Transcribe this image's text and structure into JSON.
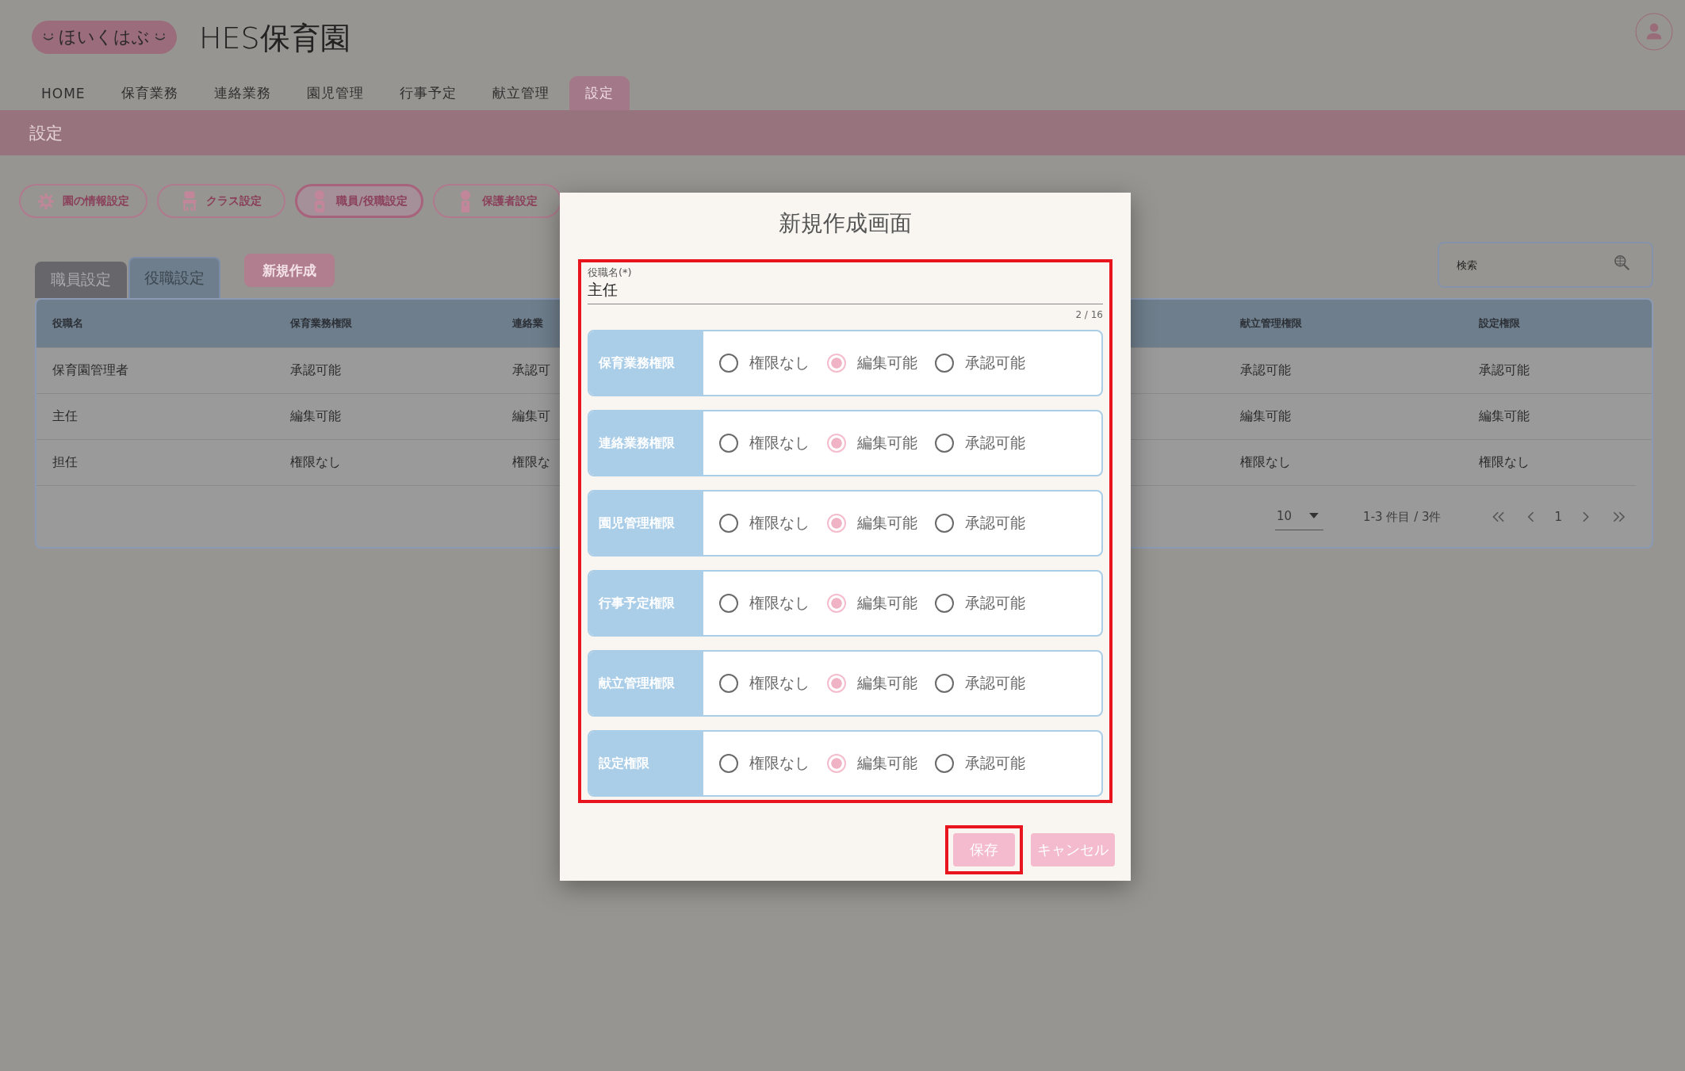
{
  "header": {
    "logo": "ほいくはぶ",
    "title": "HES保育園"
  },
  "nav": [
    {
      "label": "HOME",
      "selected": false
    },
    {
      "label": "保育業務",
      "selected": false
    },
    {
      "label": "連絡業務",
      "selected": false
    },
    {
      "label": "園児管理",
      "selected": false
    },
    {
      "label": "行事予定",
      "selected": false
    },
    {
      "label": "献立管理",
      "selected": false
    },
    {
      "label": "設定",
      "selected": true
    }
  ],
  "page_title": "設定",
  "settings_buttons": [
    {
      "label": "園の情報設定",
      "kind": "gear",
      "selected": false
    },
    {
      "label": "クラス設定",
      "kind": "chair",
      "selected": false
    },
    {
      "label": "職員/役職設定",
      "kind": "staff",
      "selected": true
    },
    {
      "label": "保護者設定",
      "kind": "guardian",
      "selected": false
    }
  ],
  "tabs": [
    {
      "label": "職員設定",
      "selected": false
    },
    {
      "label": "役職設定",
      "selected": true
    }
  ],
  "new_button": "新規作成",
  "search": {
    "placeholder": "検索"
  },
  "table": {
    "columns": [
      "役職名",
      "保育業務権限",
      "連絡業",
      "献立管理権限",
      "設定権限"
    ],
    "rows": [
      [
        "保育園管理者",
        "承認可能",
        "承認可",
        "承認可能",
        "承認可能"
      ],
      [
        "主任",
        "編集可能",
        "編集可",
        "編集可能",
        "編集可能"
      ],
      [
        "担任",
        "権限なし",
        "権限な",
        "権限なし",
        "権限なし"
      ]
    ]
  },
  "pagination": {
    "per_page": "10",
    "range": "1-3 件目 / 3件",
    "page": "1"
  },
  "dialog": {
    "title": "新規作成画面",
    "form_highlighted": true,
    "field": {
      "label": "役職名(*)",
      "value": "主任",
      "counter": "2 / 16"
    },
    "permissions": [
      {
        "label": "保育業務権限",
        "options": [
          {
            "label": "権限なし",
            "selected": false
          },
          {
            "label": "編集可能",
            "selected": true
          },
          {
            "label": "承認可能",
            "selected": false
          }
        ]
      },
      {
        "label": "連絡業務権限",
        "options": [
          {
            "label": "権限なし",
            "selected": false
          },
          {
            "label": "編集可能",
            "selected": true
          },
          {
            "label": "承認可能",
            "selected": false
          }
        ]
      },
      {
        "label": "園児管理権限",
        "options": [
          {
            "label": "権限なし",
            "selected": false
          },
          {
            "label": "編集可能",
            "selected": true
          },
          {
            "label": "承認可能",
            "selected": false
          }
        ]
      },
      {
        "label": "行事予定権限",
        "options": [
          {
            "label": "権限なし",
            "selected": false
          },
          {
            "label": "編集可能",
            "selected": true
          },
          {
            "label": "承認可能",
            "selected": false
          }
        ]
      },
      {
        "label": "献立管理権限",
        "options": [
          {
            "label": "権限なし",
            "selected": false
          },
          {
            "label": "編集可能",
            "selected": true
          },
          {
            "label": "承認可能",
            "selected": false
          }
        ]
      },
      {
        "label": "設定権限",
        "options": [
          {
            "label": "権限なし",
            "selected": false
          },
          {
            "label": "編集可能",
            "selected": true
          },
          {
            "label": "承認可能",
            "selected": false
          }
        ]
      }
    ],
    "buttons": [
      {
        "label": "保存",
        "kind": "save",
        "highlighted": true
      },
      {
        "label": "キャンセル",
        "kind": "cancel",
        "highlighted": false
      }
    ]
  }
}
